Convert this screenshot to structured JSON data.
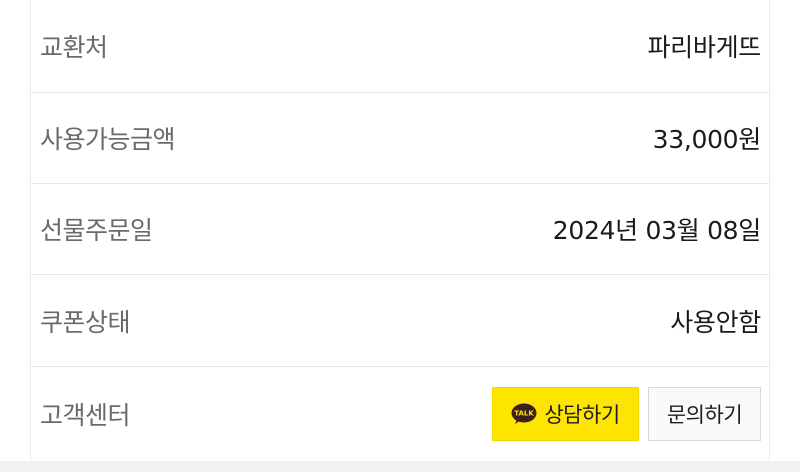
{
  "rows": [
    {
      "label": "교환처",
      "value": "파리바게뜨"
    },
    {
      "label": "사용가능금액",
      "value": "33,000원"
    },
    {
      "label": "선물주문일",
      "value": "2024년 03월 08일"
    },
    {
      "label": "쿠폰상태",
      "value": "사용안함"
    }
  ],
  "support": {
    "label": "고객센터",
    "kakao_button": "상담하기",
    "kakao_icon_text": "TALK",
    "inquiry_button": "문의하기"
  },
  "colors": {
    "kakao_yellow": "#fee500",
    "label_gray": "#6a6a6a",
    "value_dark": "#1a1a1a"
  }
}
